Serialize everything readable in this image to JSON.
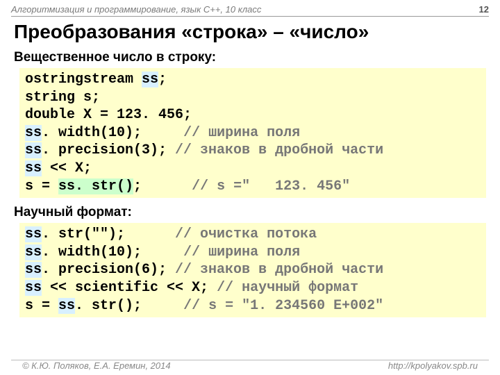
{
  "header": {
    "course": "Алгоритмизация и программирование, язык C++, 10 класс",
    "page": "12"
  },
  "title": "Преобразования «строка» – «число»",
  "section1": {
    "heading": "Вещественное число в строку:",
    "l1a": "ostringstream ",
    "l1b": "ss",
    "l1c": ";",
    "l2a": "string s;",
    "l3a": "double X = 123. 456;",
    "l4a": "ss",
    "l4b": ". width(10);     ",
    "l4c": "// ширина поля",
    "l5a": "ss",
    "l5b": ". precision(3); ",
    "l5c": "// знаков в дробной части",
    "l6a": "ss",
    "l6b": " << X;",
    "l7a": "s = ",
    "l7b": "ss. str()",
    "l7c": ";      ",
    "l7d": "// s =\"   123. 456\""
  },
  "section2": {
    "heading": "Научный формат:",
    "l1a": "ss",
    "l1b": ". str(\"\");      ",
    "l1c": "// очистка потока",
    "l2a": "ss",
    "l2b": ". width(10);     ",
    "l2c": "// ширина поля",
    "l3a": "ss",
    "l3b": ". precision(6); ",
    "l3c": "// знаков в дробной части",
    "l4a": "ss",
    "l4b": " << scientific << X; ",
    "l4c": "// научный формат",
    "l5a": "s = ",
    "l5b": "ss",
    "l5c": ". str();     ",
    "l5d": "// s = \"1. 234560 E+002\""
  },
  "footer": {
    "copyright": "© К.Ю. Поляков, Е.А. Еремин, 2014",
    "url": "http://kpolyakov.spb.ru"
  }
}
